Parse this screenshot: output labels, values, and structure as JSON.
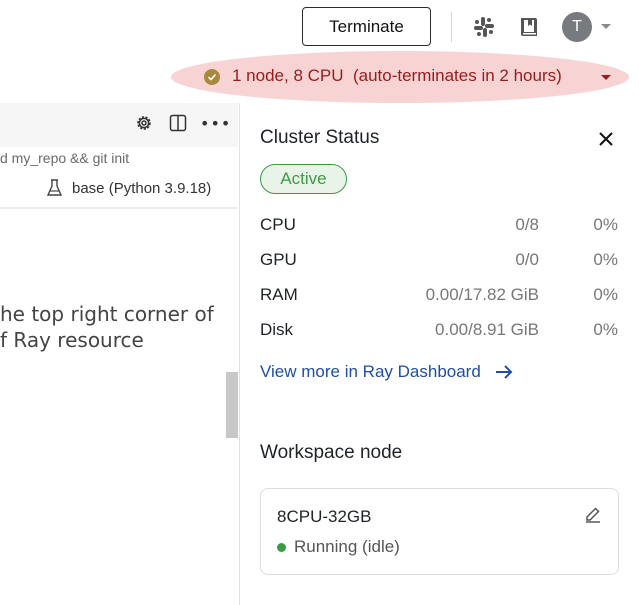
{
  "header": {
    "terminate_label": "Terminate",
    "avatar_initial": "T",
    "cluster_summary": "1 node, 8 CPU  (auto-terminates in 2 hours)"
  },
  "editor": {
    "command_text": "d my_repo && git init",
    "kernel_label": "base (Python 3.9.18)",
    "text_line_1": "he top right corner of",
    "text_line_2": "f Ray resource"
  },
  "panel": {
    "title": "Cluster Status",
    "status_badge": "Active",
    "resources": [
      {
        "name": "CPU",
        "used": "0/8",
        "pct": "0%"
      },
      {
        "name": "GPU",
        "used": "0/0",
        "pct": "0%"
      },
      {
        "name": "RAM",
        "used": "0.00/17.82 GiB",
        "pct": "0%"
      },
      {
        "name": "Disk",
        "used": "0.00/8.91 GiB",
        "pct": "0%"
      }
    ],
    "dashboard_link": "View more in Ray Dashboard",
    "workspace_title": "Workspace node",
    "node": {
      "type": "8CPU-32GB",
      "status": "Running (idle)"
    }
  },
  "colors": {
    "pill_bg": "#f7d3d4",
    "pill_text": "#9a1b1b",
    "active_green": "#3e9a46",
    "link_blue": "#1f4ea3"
  }
}
